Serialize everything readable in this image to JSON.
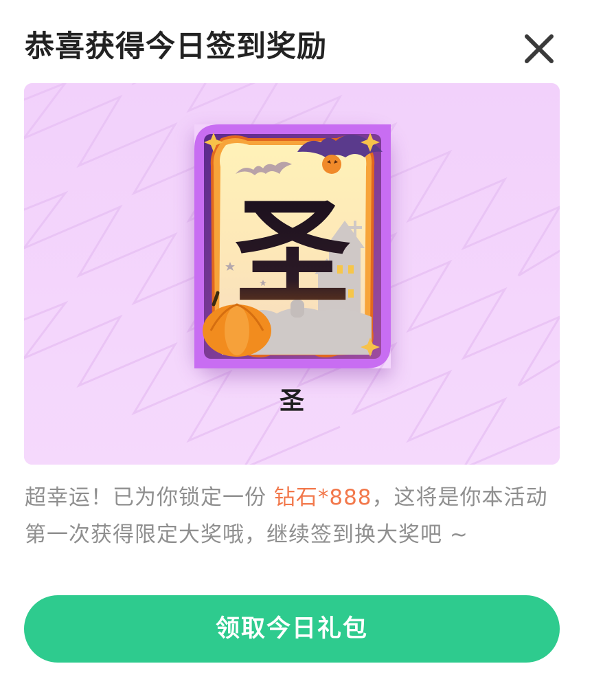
{
  "dialog": {
    "title": "恭喜获得今日签到奖励",
    "close_icon": "close-icon"
  },
  "reward": {
    "card_char": "圣",
    "card_label": "圣",
    "card_theme": "halloween",
    "card_frame_color": "#c86df2"
  },
  "message": {
    "part1": "超幸运！已为你锁定一份 ",
    "highlight": "钻石*888",
    "part2": "，这将是你本活动第一次获得限定大奖哦，继续签到换大奖吧 ~"
  },
  "claim_button": {
    "label": "领取今日礼包"
  },
  "colors": {
    "accent_green": "#2ecb8e",
    "highlight_orange": "#f2784b",
    "panel_pink": "#f3d3fb"
  }
}
